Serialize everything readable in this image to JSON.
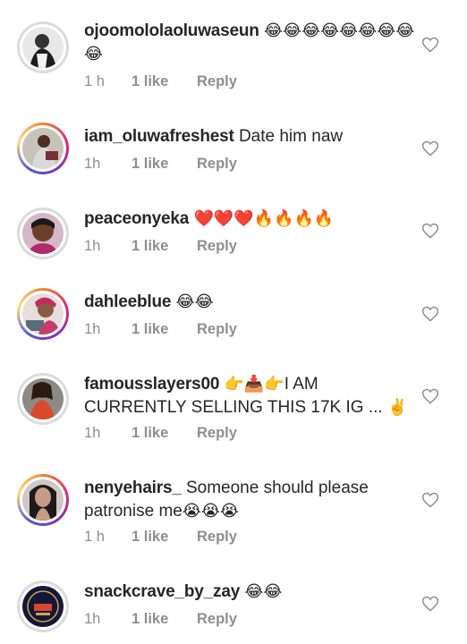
{
  "comments": [
    {
      "username": "ojoomololaoluwaseun",
      "text": "",
      "emojis": "😂😂😂😂😂😂😂😂😂",
      "time": "1 h",
      "likes": "1 like",
      "reply": "Reply",
      "story_ring": false
    },
    {
      "username": "iam_oluwafreshest",
      "text": "Date him naw",
      "emojis": "",
      "time": "1h",
      "likes": "1 like",
      "reply": "Reply",
      "story_ring": true
    },
    {
      "username": "peaceonyeka",
      "text": "",
      "emojis": "❤️❤️❤️🔥🔥🔥🔥",
      "time": "1h",
      "likes": "1 like",
      "reply": "Reply",
      "story_ring": false
    },
    {
      "username": "dahleeblue",
      "text": "",
      "emojis": "😂😂",
      "time": "1h",
      "likes": "1 like",
      "reply": "Reply",
      "story_ring": true
    },
    {
      "username": "famousslayers00",
      "text": "I AM CURRENTLY SELLING THIS 17K IG ...",
      "emojis_before": "👉📥👉",
      "emojis_after": "✌️",
      "time": "1h",
      "likes": "1 like",
      "reply": "Reply",
      "story_ring": false
    },
    {
      "username": "nenyehairs_",
      "text": "Someone should please patronise me",
      "emojis": "😭😭😭",
      "time": "1 h",
      "likes": "1 like",
      "reply": "Reply",
      "story_ring": true
    },
    {
      "username": "snackcrave_by_zay",
      "text": "",
      "emojis": "😂😂",
      "time": "1h",
      "likes": "1 like",
      "reply": "Reply",
      "story_ring": false
    }
  ],
  "colors": {
    "text": "#262626",
    "meta": "#8e8e8e",
    "heart_outline": "#8e8e8e"
  },
  "icons": {
    "like": "heart-outline-icon"
  }
}
